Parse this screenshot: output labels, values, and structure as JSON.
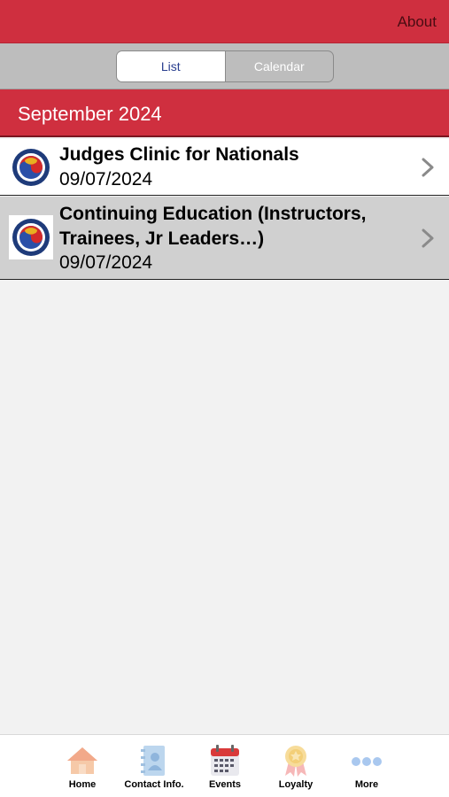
{
  "header": {
    "about_label": "About"
  },
  "segment": {
    "list_label": "List",
    "calendar_label": "Calendar"
  },
  "section": {
    "title": "September 2024"
  },
  "events": [
    {
      "title": "Judges Clinic for Nationals",
      "date": "09/07/2024"
    },
    {
      "title": "Continuing Education (Instructors, Trainees, Jr Leaders…)",
      "date": "09/07/2024"
    }
  ],
  "tabbar": {
    "items": [
      {
        "label": "Home",
        "icon": "home-icon"
      },
      {
        "label": "Contact Info.",
        "icon": "contact-book-icon"
      },
      {
        "label": "Events",
        "icon": "calendar-icon"
      },
      {
        "label": "Loyalty",
        "icon": "ribbon-badge-icon"
      },
      {
        "label": "More",
        "icon": "more-dots-icon"
      }
    ]
  },
  "colors": {
    "brand_red": "#cf2f3f",
    "segment_gray": "#bdbdbd",
    "selected_row": "#d0d0d0"
  }
}
